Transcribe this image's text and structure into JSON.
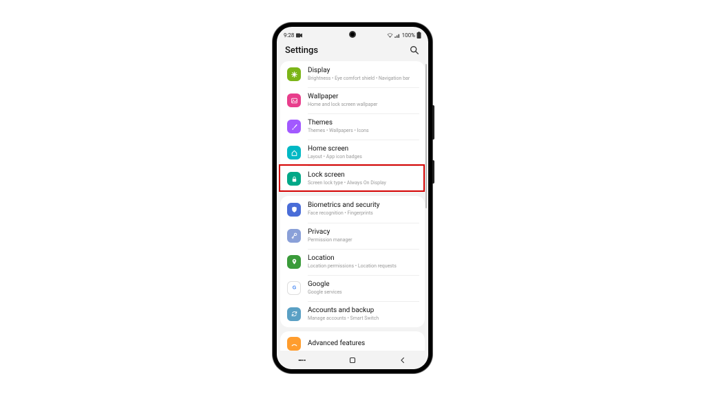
{
  "status": {
    "time": "9:28",
    "battery": "100%"
  },
  "header": {
    "title": "Settings"
  },
  "groups": [
    {
      "items": [
        {
          "key": "display",
          "icon": "asterisk",
          "color": "#7cb518",
          "title": "Display",
          "sub": "Brightness  •  Eye comfort shield  •  Navigation bar"
        },
        {
          "key": "wallpaper",
          "icon": "image",
          "color": "#e83e8c",
          "title": "Wallpaper",
          "sub": "Home and lock screen wallpaper"
        },
        {
          "key": "themes",
          "icon": "brush",
          "color": "#a259ff",
          "title": "Themes",
          "sub": "Themes  •  Wallpapers  •  Icons"
        },
        {
          "key": "homescreen",
          "icon": "home",
          "color": "#00b8c4",
          "title": "Home screen",
          "sub": "Layout  •  App icon badges"
        },
        {
          "key": "lockscreen",
          "icon": "lock",
          "color": "#00a887",
          "title": "Lock screen",
          "sub": "Screen lock type  •  Always On Display"
        }
      ]
    },
    {
      "items": [
        {
          "key": "biometrics",
          "icon": "shield",
          "color": "#4a6dd8",
          "title": "Biometrics and security",
          "sub": "Face recognition  •  Fingerprints"
        },
        {
          "key": "privacy",
          "icon": "key",
          "color": "#8aa0d8",
          "title": "Privacy",
          "sub": "Permission manager"
        },
        {
          "key": "location",
          "icon": "pin",
          "color": "#3a9b3a",
          "title": "Location",
          "sub": "Location permissions  •  Location requests"
        },
        {
          "key": "google",
          "icon": "google",
          "color": "#ffffff",
          "title": "Google",
          "sub": "Google services"
        },
        {
          "key": "accounts",
          "icon": "sync",
          "color": "#5aa0c4",
          "title": "Accounts and backup",
          "sub": "Manage accounts  •  Smart Switch"
        }
      ]
    }
  ],
  "peek": {
    "key": "advanced",
    "icon": "arc",
    "color": "#ff9d2e",
    "title": "Advanced features"
  },
  "highlight_key": "lockscreen"
}
